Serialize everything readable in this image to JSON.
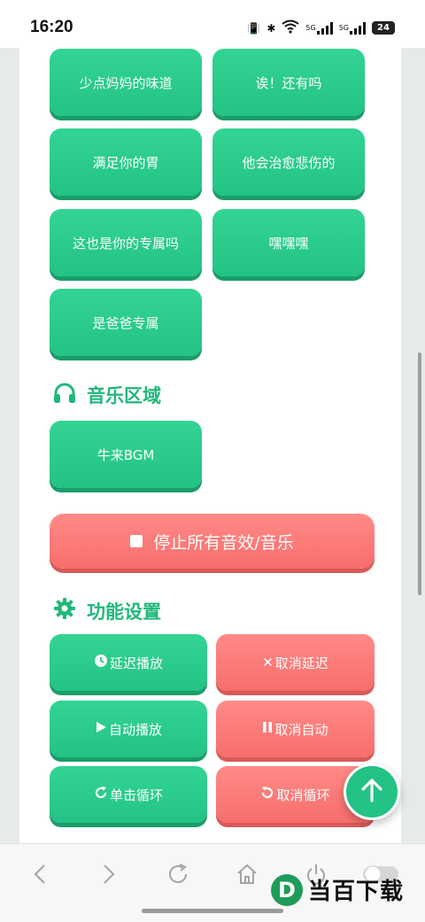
{
  "status_bar": {
    "time": "16:20",
    "battery": "24",
    "network_label_1": "5G",
    "network_label_2": "5G"
  },
  "sound_buttons": [
    "少点妈妈的味道",
    "诶！还有吗",
    "满足你的胃",
    "他会治愈悲伤的",
    "这也是你的专属吗",
    "嘿嘿嘿",
    "是爸爸专属"
  ],
  "music_section": {
    "title": "音乐区域",
    "icon": "headphones-icon",
    "buttons": [
      "牛来BGM"
    ]
  },
  "stop_all": {
    "label": "停止所有音效/音乐",
    "icon": "stop-square-icon"
  },
  "settings_section": {
    "title": "功能设置",
    "icon": "gear-icon",
    "delay_play": "延迟播放",
    "cancel_delay": "取消延迟",
    "auto_play": "自动播放",
    "cancel_auto": "取消自动",
    "single_loop": "单击循环",
    "cancel_loop": "取消循环"
  },
  "scroll_top_icon": "arrow-up-icon",
  "watermark": {
    "text": "当百下载",
    "logo_letter": "D"
  },
  "colors": {
    "green": "#22c384",
    "red": "#f76e6c",
    "title_green": "#21b77b"
  }
}
